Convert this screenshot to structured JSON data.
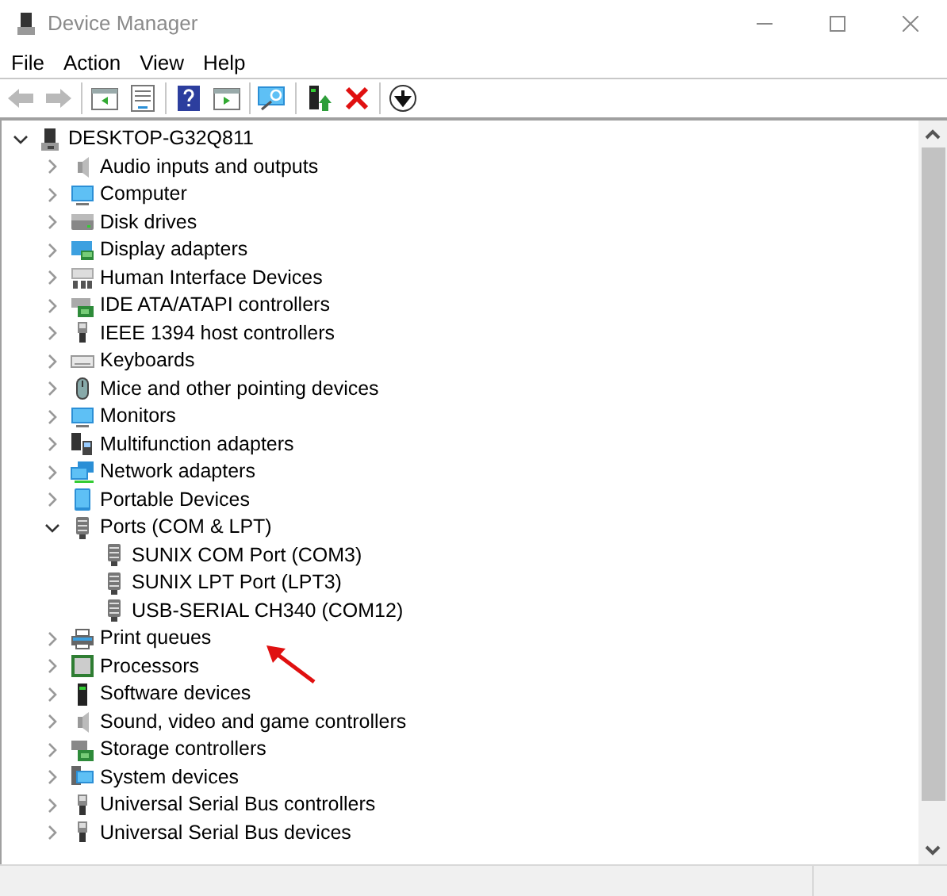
{
  "window": {
    "title": "Device Manager"
  },
  "menu": [
    "File",
    "Action",
    "View",
    "Help"
  ],
  "toolbar": [
    {
      "kind": "back",
      "disabled": true
    },
    {
      "kind": "forward",
      "disabled": true
    },
    {
      "kind": "panel-left",
      "disabled": false
    },
    {
      "kind": "properties",
      "disabled": false
    },
    {
      "kind": "help",
      "disabled": false
    },
    {
      "kind": "panel-right",
      "disabled": false
    },
    {
      "kind": "scan",
      "disabled": false
    },
    {
      "kind": "update",
      "disabled": false
    },
    {
      "kind": "remove",
      "disabled": false
    },
    {
      "kind": "download",
      "disabled": false
    }
  ],
  "tree": {
    "label": "DESKTOP-G32Q811",
    "kind": "pc",
    "expanded": true,
    "children": [
      {
        "label": "Audio inputs and outputs",
        "kind": "speaker",
        "expanded": false
      },
      {
        "label": "Computer",
        "kind": "monitor",
        "expanded": false
      },
      {
        "label": "Disk drives",
        "kind": "disk",
        "expanded": false
      },
      {
        "label": "Display adapters",
        "kind": "display",
        "expanded": false
      },
      {
        "label": "Human Interface Devices",
        "kind": "hid",
        "expanded": false
      },
      {
        "label": "IDE ATA/ATAPI controllers",
        "kind": "card",
        "expanded": false
      },
      {
        "label": "IEEE 1394 host controllers",
        "kind": "plug",
        "expanded": false
      },
      {
        "label": "Keyboards",
        "kind": "keyboard",
        "expanded": false
      },
      {
        "label": "Mice and other pointing devices",
        "kind": "mouse",
        "expanded": false
      },
      {
        "label": "Monitors",
        "kind": "monitor",
        "expanded": false
      },
      {
        "label": "Multifunction adapters",
        "kind": "multi",
        "expanded": false
      },
      {
        "label": "Network adapters",
        "kind": "network",
        "expanded": false
      },
      {
        "label": "Portable Devices",
        "kind": "portable",
        "expanded": false
      },
      {
        "label": "Ports (COM & LPT)",
        "kind": "port",
        "expanded": true,
        "children": [
          {
            "label": "SUNIX COM Port (COM3)",
            "kind": "port"
          },
          {
            "label": "SUNIX LPT Port (LPT3)",
            "kind": "port"
          },
          {
            "label": "USB-SERIAL CH340 (COM12)",
            "kind": "port"
          }
        ]
      },
      {
        "label": "Print queues",
        "kind": "printer",
        "expanded": false
      },
      {
        "label": "Processors",
        "kind": "chip",
        "expanded": false
      },
      {
        "label": "Software devices",
        "kind": "software",
        "expanded": false
      },
      {
        "label": "Sound, video and game controllers",
        "kind": "speaker",
        "expanded": false
      },
      {
        "label": "Storage controllers",
        "kind": "storage",
        "expanded": false
      },
      {
        "label": "System devices",
        "kind": "system",
        "expanded": false
      },
      {
        "label": "Universal Serial Bus controllers",
        "kind": "plug",
        "expanded": false
      },
      {
        "label": "Universal Serial Bus devices",
        "kind": "plug",
        "expanded": false
      }
    ]
  }
}
